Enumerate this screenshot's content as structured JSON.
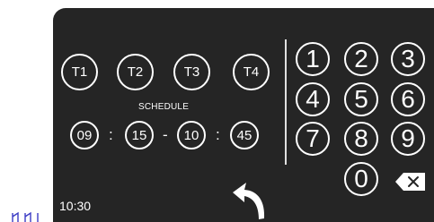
{
  "colors": {
    "panel_bg": "#252525",
    "foreground": "#ffffff",
    "page_bg": "#ffffff",
    "corner_marks": "#3b3bc4"
  },
  "timer_buttons": [
    {
      "label": "T1"
    },
    {
      "label": "T2"
    },
    {
      "label": "T3"
    },
    {
      "label": "T4"
    }
  ],
  "schedule": {
    "label": "SCHEDULE",
    "start_hour": "09",
    "colon_1": ":",
    "start_minute": "15",
    "dash": "-",
    "end_hour": "10",
    "colon_2": ":",
    "end_minute": "45"
  },
  "keypad": {
    "keys": [
      "1",
      "2",
      "3",
      "4",
      "5",
      "6",
      "7",
      "8",
      "9",
      "0"
    ],
    "backspace_icon": "backspace-icon"
  },
  "footer": {
    "time": "10:30",
    "back_icon": "back-arrow-icon"
  }
}
